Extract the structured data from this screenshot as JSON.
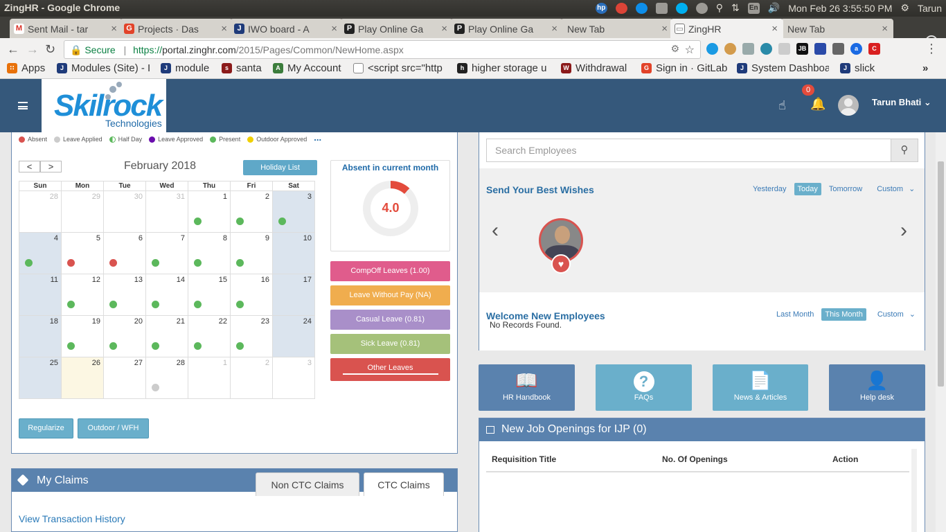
{
  "os_bar": {
    "title": "ZingHR - Google Chrome",
    "lang": "En",
    "datetime": "Mon Feb 26  3:55:50 PM",
    "user": "Tarun"
  },
  "browser": {
    "tabs": [
      {
        "label": "Sent Mail - tar",
        "color": "#d93025",
        "glyph": "M"
      },
      {
        "label": "Projects · Das",
        "color": "#e24329",
        "glyph": "G"
      },
      {
        "label": "IWO board - A",
        "color": "#1f3b7a",
        "glyph": "J"
      },
      {
        "label": "Play Online Ga",
        "color": "#222",
        "glyph": "P"
      },
      {
        "label": "Play Online Ga",
        "color": "#222",
        "glyph": "P"
      },
      {
        "label": "New Tab",
        "color": "",
        "glyph": ""
      },
      {
        "label": "ZingHR",
        "color": "#777",
        "glyph": "Z"
      },
      {
        "label": "New Tab",
        "color": "",
        "glyph": ""
      }
    ],
    "url_secure": "Secure",
    "url_scheme": "https://",
    "url_host": "portal.zinghr.com",
    "url_path": "/2015/Pages/Common/NewHome.aspx",
    "bookmarks": [
      {
        "label": "Apps",
        "color": "#e8710a"
      },
      {
        "label": "Modules (Site) - I",
        "color": "#1f3b7a"
      },
      {
        "label": "module",
        "color": "#1f3b7a"
      },
      {
        "label": "santa",
        "color": "#8b1a1a"
      },
      {
        "label": "My Account",
        "color": "#3c7d3c"
      },
      {
        "label": "<script src=\"http",
        "color": "#888"
      },
      {
        "label": "higher storage u",
        "color": "#222"
      },
      {
        "label": "Withdrawal",
        "color": "#8b1a1a"
      },
      {
        "label": "Sign in · GitLab",
        "color": "#e24329"
      },
      {
        "label": "System Dashboa",
        "color": "#1f3b7a"
      },
      {
        "label": "slick",
        "color": "#1f3b7a"
      }
    ]
  },
  "header": {
    "logo_main": "Skilrock",
    "logo_sub": "Technologies",
    "notif_count": "0",
    "user_name": "Tarun Bhati"
  },
  "legend": [
    {
      "label": "Absent",
      "color": "#d9534f"
    },
    {
      "label": "Leave Applied",
      "color": "#cccccc"
    },
    {
      "label": "Half Day",
      "color": "#5cb85c"
    },
    {
      "label": "Leave Approved",
      "color": "#6a0dad"
    },
    {
      "label": "Present",
      "color": "#5cb85c"
    },
    {
      "label": "Outdoor Approved",
      "color": "#f0d000"
    }
  ],
  "legend_more": "...",
  "calendar": {
    "prev": "<",
    "next": ">",
    "month_label": "February 2018",
    "holiday_btn": "Holiday List",
    "days": [
      "Sun",
      "Mon",
      "Tue",
      "Wed",
      "Thu",
      "Fri",
      "Sat"
    ],
    "weeks": [
      [
        {
          "d": "28",
          "o": true
        },
        {
          "d": "29",
          "o": true
        },
        {
          "d": "30",
          "o": true
        },
        {
          "d": "31",
          "o": true
        },
        {
          "d": "1",
          "m": "present"
        },
        {
          "d": "2",
          "m": "present"
        },
        {
          "d": "3",
          "m": "present",
          "we": true
        }
      ],
      [
        {
          "d": "4",
          "m": "present",
          "we": true
        },
        {
          "d": "5",
          "m": "absent"
        },
        {
          "d": "6",
          "m": "absent"
        },
        {
          "d": "7",
          "m": "present"
        },
        {
          "d": "8",
          "m": "present"
        },
        {
          "d": "9",
          "m": "present"
        },
        {
          "d": "10",
          "we": true
        }
      ],
      [
        {
          "d": "11",
          "we": true
        },
        {
          "d": "12",
          "m": "present"
        },
        {
          "d": "13",
          "m": "present"
        },
        {
          "d": "14",
          "m": "present"
        },
        {
          "d": "15",
          "m": "present"
        },
        {
          "d": "16",
          "m": "present"
        },
        {
          "d": "17",
          "we": true
        }
      ],
      [
        {
          "d": "18",
          "we": true
        },
        {
          "d": "19",
          "m": "present"
        },
        {
          "d": "20",
          "m": "present"
        },
        {
          "d": "21",
          "m": "present"
        },
        {
          "d": "22",
          "m": "present"
        },
        {
          "d": "23",
          "m": "present"
        },
        {
          "d": "24",
          "we": true
        }
      ],
      [
        {
          "d": "25",
          "we": true
        },
        {
          "d": "26",
          "today": true
        },
        {
          "d": "27"
        },
        {
          "d": "28",
          "m": "applied"
        },
        {
          "d": "1",
          "o": true
        },
        {
          "d": "2",
          "o": true
        },
        {
          "d": "3",
          "o": true
        }
      ]
    ]
  },
  "absent": {
    "title": "Absent in current month",
    "value": "4.0"
  },
  "leaves": [
    {
      "label": "CompOff Leaves (1.00)",
      "color": "#e05c8c"
    },
    {
      "label": "Leave Without Pay (NA)",
      "color": "#f0ad4e"
    },
    {
      "label": "Casual Leave (0.81)",
      "color": "#a98fc9"
    },
    {
      "label": "Sick Leave (0.81)",
      "color": "#a5c17a"
    },
    {
      "label": "Other Leaves",
      "color": "#d9534f"
    }
  ],
  "actions": {
    "regularize": "Regularize",
    "outdoor": "Outdoor / WFH"
  },
  "claims": {
    "title": "My Claims",
    "tab1": "Non CTC Claims",
    "tab2": "CTC Claims",
    "link": "View Transaction History"
  },
  "right": {
    "search_placeholder": "Search Employees",
    "wishes_title": "Send Your Best Wishes",
    "wishes_filters": [
      "Yesterday",
      "Today",
      "Tomorrow",
      "Custom"
    ],
    "welcome_title": "Welcome New Employees",
    "welcome_filters": [
      "Last Month",
      "This Month",
      "Custom"
    ],
    "no_records": "No Records Found.",
    "quick": [
      {
        "label": "HR Handbook",
        "icon": "book-icon",
        "color": "#5a82ae"
      },
      {
        "label": "FAQs",
        "icon": "question-icon",
        "color": "#6aafcb"
      },
      {
        "label": "News & Articles",
        "icon": "document-icon",
        "color": "#6aafcb"
      },
      {
        "label": "Help desk",
        "icon": "user-icon",
        "color": "#5a82ae"
      }
    ],
    "jobs_title": "New Job Openings for IJP (0)",
    "jobs_cols": [
      "Requisition Title",
      "No. Of Openings",
      "Action"
    ]
  }
}
